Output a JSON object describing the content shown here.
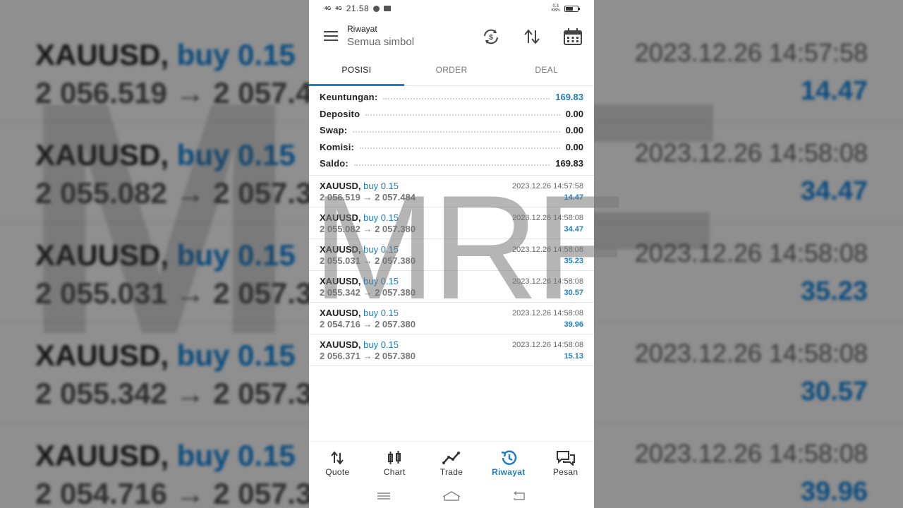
{
  "status_bar": {
    "signal_1": "4G",
    "signal_2": "4G",
    "time": "21.58",
    "net_speed": "0.3",
    "net_unit": "KB/s"
  },
  "app_bar": {
    "title": "Riwayat",
    "subtitle": "Semua simbol"
  },
  "tabs": [
    {
      "label": "POSISI",
      "active": true
    },
    {
      "label": "ORDER",
      "active": false
    },
    {
      "label": "DEAL",
      "active": false
    }
  ],
  "summary": [
    {
      "label": "Keuntungan:",
      "value": "169.83",
      "highlight": true
    },
    {
      "label": "Deposito",
      "value": "0.00",
      "highlight": false
    },
    {
      "label": "Swap:",
      "value": "0.00",
      "highlight": false
    },
    {
      "label": "Komisi:",
      "value": "0.00",
      "highlight": false
    },
    {
      "label": "Saldo:",
      "value": "169.83",
      "highlight": false
    }
  ],
  "deals": [
    {
      "symbol": "XAUUSD,",
      "side": "buy 0.15",
      "open": "2 056.519",
      "close": "2 057.484",
      "time": "2023.12.26 14:57:58",
      "profit": "14.47"
    },
    {
      "symbol": "XAUUSD,",
      "side": "buy 0.15",
      "open": "2 055.082",
      "close": "2 057.380",
      "time": "2023.12.26 14:58:08",
      "profit": "34.47"
    },
    {
      "symbol": "XAUUSD,",
      "side": "buy 0.15",
      "open": "2 055.031",
      "close": "2 057.380",
      "time": "2023.12.26 14:58:08",
      "profit": "35.23"
    },
    {
      "symbol": "XAUUSD,",
      "side": "buy 0.15",
      "open": "2 055.342",
      "close": "2 057.380",
      "time": "2023.12.26 14:58:08",
      "profit": "30.57"
    },
    {
      "symbol": "XAUUSD,",
      "side": "buy 0.15",
      "open": "2 054.716",
      "close": "2 057.380",
      "time": "2023.12.26 14:58:08",
      "profit": "39.96"
    },
    {
      "symbol": "XAUUSD,",
      "side": "buy 0.15",
      "open": "2 056.371",
      "close": "2 057.380",
      "time": "2023.12.26 14:58:08",
      "profit": "15.13"
    }
  ],
  "arrow": "→",
  "watermark": "MRF",
  "bottom_nav": [
    {
      "label": "Quote",
      "icon": "quote-arrows-icon",
      "active": false
    },
    {
      "label": "Chart",
      "icon": "candlestick-icon",
      "active": false
    },
    {
      "label": "Trade",
      "icon": "trade-line-icon",
      "active": false
    },
    {
      "label": "Riwayat",
      "icon": "history-clock-icon",
      "active": true
    },
    {
      "label": "Pesan",
      "icon": "chat-bubbles-icon",
      "active": false
    }
  ],
  "colors": {
    "accent": "#1f7fc4",
    "text": "#222222",
    "muted": "#777777"
  }
}
